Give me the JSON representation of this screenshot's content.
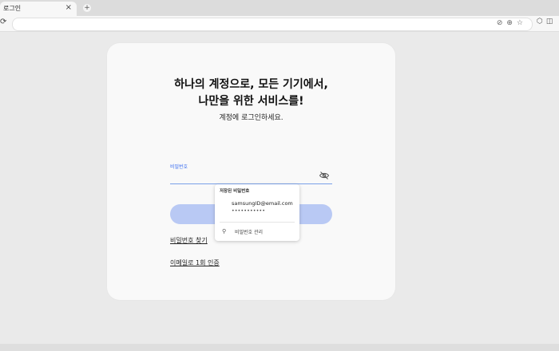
{
  "browser": {
    "tab_title": "로그인",
    "tab_close": "×",
    "new_tab": "+",
    "reload_icon": "⟳",
    "omnibox_icons": "⊘⊕☆",
    "toolbar_icons": "⬡◫"
  },
  "card": {
    "headline_line1": "하나의 계정으로, 모든 기기에서,",
    "headline_line2": "나만을 위한 서비스를!",
    "subline": "계정에 로그인하세요.",
    "password_label": "비밀번호",
    "submit_label": "",
    "find_password_link": "비밀번호 찾기",
    "email_auth_link": "이메일로 1회 인증"
  },
  "autofill": {
    "header": "저장된 비밀번호",
    "saved_username": "samsungID@email.com",
    "saved_password_mask": "•••••••••••",
    "manage_label": "비밀번호 관리",
    "key_icon": "⚲"
  },
  "colors": {
    "accent": "#3b6ef0",
    "button_disabled": "#b9c9f4"
  }
}
